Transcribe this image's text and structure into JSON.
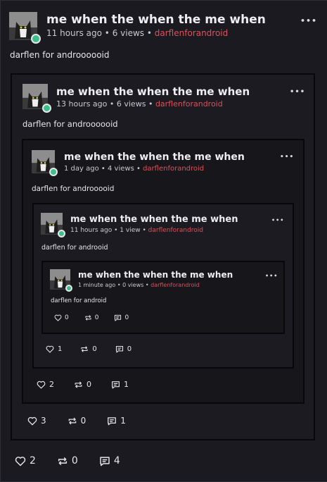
{
  "posts": [
    {
      "title": "me when the when the me when",
      "time": "11 hours ago",
      "views": "6 views",
      "author": "darflenforandroid",
      "body": "darflen for androooooid",
      "likes": "2",
      "reposts": "0",
      "comments": "4"
    },
    {
      "title": "me when the when the me when",
      "time": "13 hours ago",
      "views": "6 views",
      "author": "darflenforandroid",
      "body": "darflen for androooooid",
      "likes": "3",
      "reposts": "0",
      "comments": "1"
    },
    {
      "title": "me when the when the me when",
      "time": "1 day ago",
      "views": "4 views",
      "author": "darflenforandroid",
      "body": "darflen for androoooid",
      "likes": "2",
      "reposts": "0",
      "comments": "1"
    },
    {
      "title": "me when the when the me when",
      "time": "11 hours ago",
      "views": "1 view",
      "author": "darflenforandroid",
      "body": "darflen for androoid",
      "likes": "1",
      "reposts": "0",
      "comments": "0"
    },
    {
      "title": "me when the when the me when",
      "time": "1 minute ago",
      "views": "0 views",
      "author": "darflenforandroid",
      "body": "darflen for android",
      "likes": "0",
      "reposts": "0",
      "comments": "0"
    }
  ],
  "separator": "•",
  "more_label": "•••",
  "icons": {
    "like": "heart-icon",
    "repost": "repost-icon",
    "comment": "comment-icon"
  },
  "colors": {
    "author": "#e0505a",
    "status": "#3fbf8a",
    "background": "#1a1a20"
  }
}
